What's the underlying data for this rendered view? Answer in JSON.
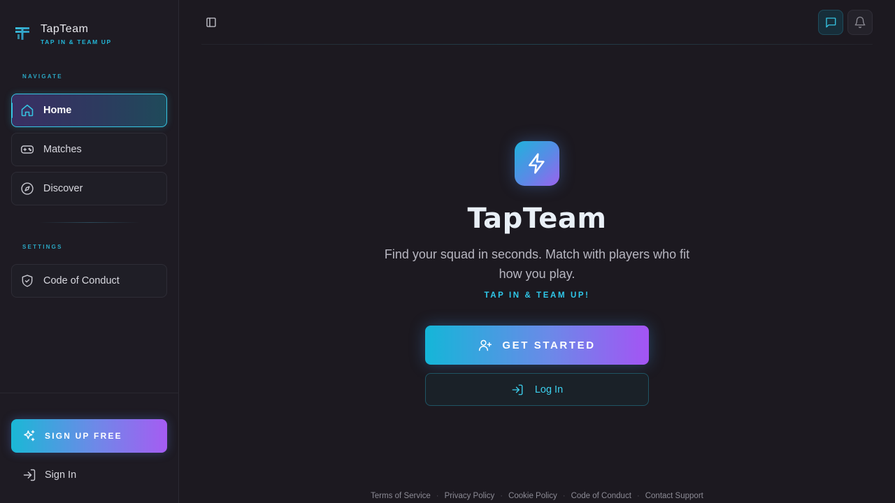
{
  "brand": {
    "name": "TapTeam",
    "tagline": "TAP IN & TEAM UP"
  },
  "sidebar": {
    "navigate_label": "NAVIGATE",
    "items": [
      {
        "label": "Home",
        "icon": "home-icon",
        "active": true
      },
      {
        "label": "Matches",
        "icon": "gamepad-icon",
        "active": false
      },
      {
        "label": "Discover",
        "icon": "compass-icon",
        "active": false
      }
    ],
    "settings_label": "SETTINGS",
    "settings_items": [
      {
        "label": "Code of Conduct",
        "icon": "shield-check-icon"
      }
    ],
    "signup_label": "SIGN UP FREE",
    "signin_label": "Sign In"
  },
  "topbar": {
    "toggle_icon": "sidebar-toggle-icon",
    "chat_icon": "chat-icon",
    "bell_icon": "bell-icon"
  },
  "hero": {
    "title": "TapTeam",
    "subtitle": "Find your squad in seconds. Match with players who fit how you play.",
    "tagline": "TAP IN & TEAM UP!",
    "cta_label": "GET STARTED",
    "login_label": "Log In"
  },
  "footer": {
    "links": [
      "Terms of Service",
      "Privacy Policy",
      "Cookie Policy",
      "Code of Conduct",
      "Contact Support"
    ]
  },
  "colors": {
    "background": "#1c1920",
    "sidebar": "#1e1b23",
    "accent_cyan": "#2fc8ea",
    "accent_purple": "#a454f4"
  }
}
